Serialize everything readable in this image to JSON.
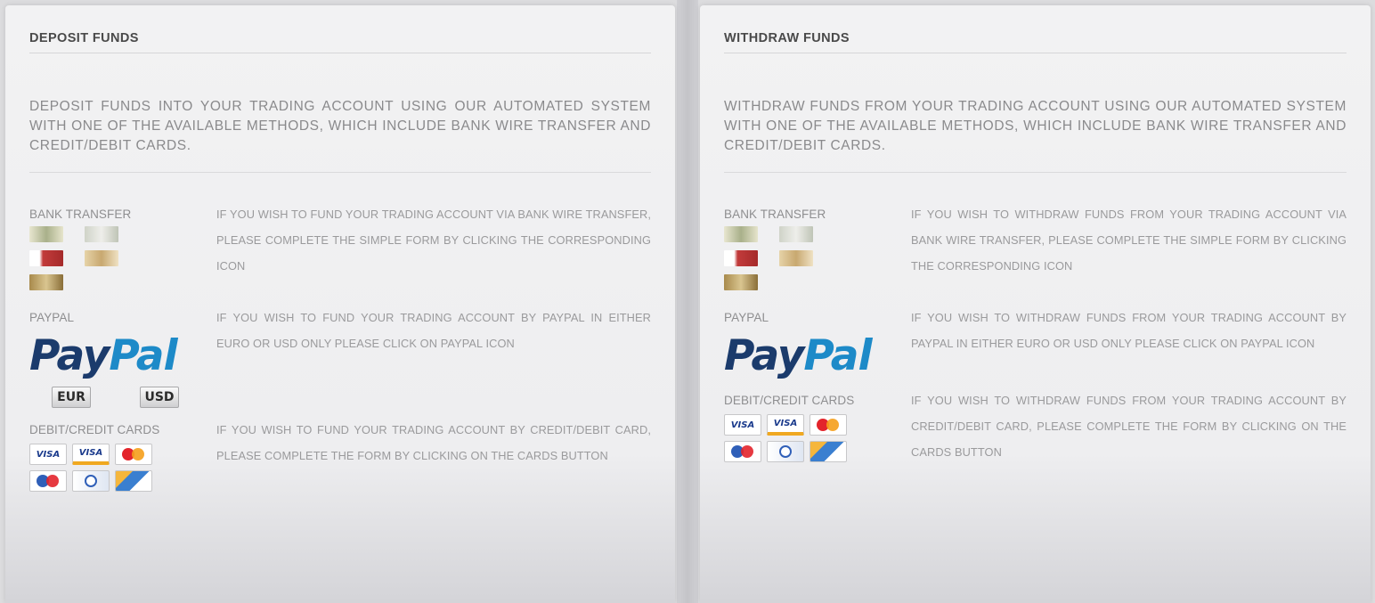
{
  "deposit": {
    "title": "DEPOSIT FUNDS",
    "intro": "DEPOSIT FUNDS INTO YOUR TRADING ACCOUNT USING OUR AUTOMATED SYSTEM WITH ONE OF THE AVAILABLE METHODS, WHICH INCLUDE BANK WIRE TRANSFER AND CREDIT/DEBIT CARDS.",
    "bank_label": "BANK TRANSFER",
    "bank_desc": "IF YOU WISH TO FUND YOUR TRADING ACCOUNT VIA BANK WIRE TRANSFER, PLEASE COMPLETE THE SIMPLE FORM BY CLICKING THE CORRESPONDING ICON",
    "paypal_label": "PAYPAL",
    "paypal_logo_pay": "Pay",
    "paypal_logo_pal": "Pal",
    "paypal_desc": "IF YOU WISH TO FUND YOUR TRADING ACCOUNT BY PAYPAL IN EITHER EURO OR USD ONLY PLEASE CLICK ON PAYPAL ICON",
    "eur_label": "EUR",
    "usd_label": "USD",
    "cards_label": "DEBIT/CREDIT CARDS",
    "cards_desc": "IF YOU WISH TO FUND YOUR TRADING ACCOUNT BY CREDIT/DEBIT CARD, PLEASE COMPLETE THE FORM BY CLICKING ON THE CARDS BUTTON"
  },
  "withdraw": {
    "title": "WITHDRAW FUNDS",
    "intro": "WITHDRAW FUNDS FROM YOUR TRADING ACCOUNT USING OUR AUTOMATED SYSTEM WITH ONE OF THE AVAILABLE METHODS, WHICH INCLUDE BANK WIRE TRANSFER AND CREDIT/DEBIT CARDS.",
    "bank_label": "BANK TRANSFER",
    "bank_desc": "IF YOU WISH TO WITHDRAW FUNDS FROM YOUR TRADING ACCOUNT VIA BANK WIRE TRANSFER, PLEASE COMPLETE THE SIMPLE FORM BY CLICKING THE CORRESPONDING ICON",
    "paypal_label": "PAYPAL",
    "paypal_logo_pay": "Pay",
    "paypal_logo_pal": "Pal",
    "paypal_desc": "IF YOU WISH TO WITHDRAW FUNDS FROM YOUR TRADING ACCOUNT BY PAYPAL IN EITHER EURO OR USD ONLY PLEASE CLICK ON PAYPAL ICON",
    "cards_label": "DEBIT/CREDIT CARDS",
    "cards_desc": "IF YOU WISH TO WITHDRAW FUNDS FROM YOUR TRADING ACCOUNT BY CREDIT/DEBIT CARD, PLEASE COMPLETE THE FORM BY CLICKING ON THE CARDS BUTTON"
  },
  "card_labels": {
    "visa": "VISA",
    "visa_electron": "VISA"
  },
  "bank_icon_colors": [
    "#c9c7a0",
    "#d4d6c8",
    "#c23b3b",
    "#d9c59a",
    "#b99b5a"
  ],
  "colors": {
    "paypal_dark": "#1b3b6c",
    "paypal_light": "#1d8ac8",
    "text": "#8a8a8c"
  }
}
